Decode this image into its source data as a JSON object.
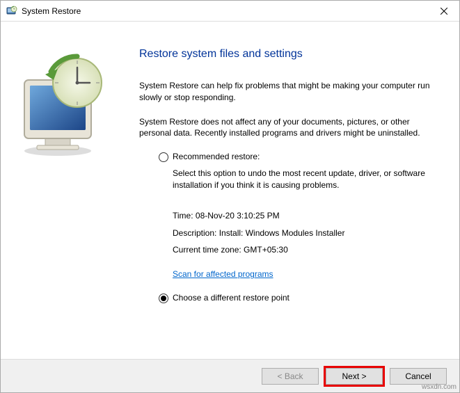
{
  "titlebar": {
    "title": "System Restore"
  },
  "heading": "Restore system files and settings",
  "para1": "System Restore can help fix problems that might be making your computer run slowly or stop responding.",
  "para2": "System Restore does not affect any of your documents, pictures, or other personal data. Recently installed programs and drivers might be uninstalled.",
  "options": {
    "recommended": {
      "label": "Recommended restore:",
      "desc": "Select this option to undo the most recent update, driver, or software installation if you think it is causing problems.",
      "time_label": "Time: ",
      "time_value": "08-Nov-20 3:10:25 PM",
      "desc_label": "Description: ",
      "desc_value": "Install: Windows Modules Installer",
      "tz_label": "Current time zone: ",
      "tz_value": "GMT+05:30",
      "scan_link": "Scan for affected programs"
    },
    "different": {
      "label": "Choose a different restore point"
    }
  },
  "buttons": {
    "back": "< Back",
    "next": "Next >",
    "cancel": "Cancel"
  },
  "watermark": "wsxdn.com"
}
